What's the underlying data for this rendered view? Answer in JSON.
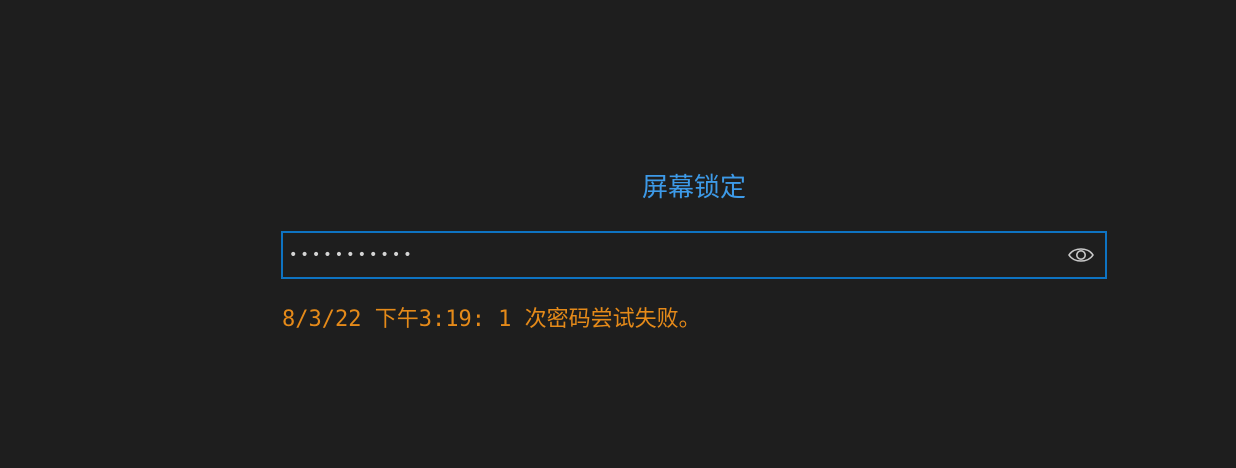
{
  "lock": {
    "title": "屏幕锁定",
    "password_value": "•••••••••••",
    "toggle_icon": "eye-icon",
    "error_message": "8/3/22 下午3:19: 1 次密码尝试失败。"
  },
  "colors": {
    "background": "#1e1e1e",
    "title": "#3d9ae8",
    "input_border": "#0e73c2",
    "error": "#e58a19"
  }
}
